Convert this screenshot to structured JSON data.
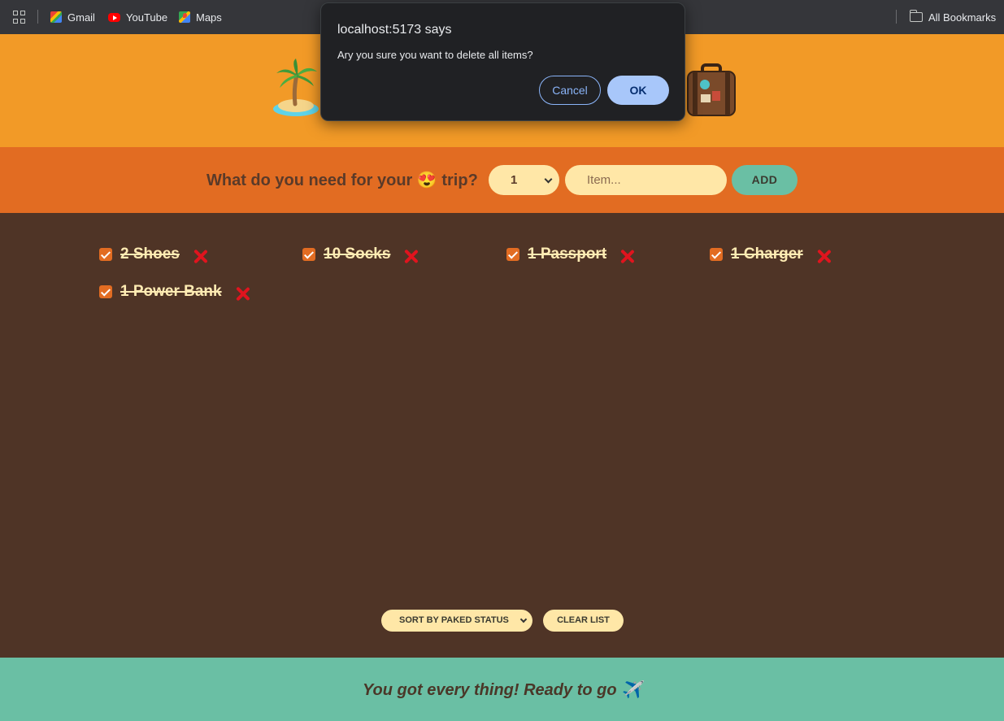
{
  "bookmarks": {
    "items": [
      {
        "label": "Gmail",
        "icon": "gmail-icon"
      },
      {
        "label": "YouTube",
        "icon": "youtube-icon"
      },
      {
        "label": "Maps",
        "icon": "maps-icon"
      }
    ],
    "all_bookmarks": "All Bookmarks"
  },
  "header": {
    "left_emoji": "palm-tree-island-icon",
    "right_emoji": "suitcase-icon",
    "background": "#f29a27"
  },
  "form": {
    "question": "What do you need for your 😍 trip?",
    "quantity_selected": "1",
    "item_placeholder": "Item...",
    "add_label": "ADD"
  },
  "items": [
    {
      "quantity": 2,
      "description": "Shoes",
      "label": "2 Shoes",
      "packed": true
    },
    {
      "quantity": 10,
      "description": "Socks",
      "label": "10 Socks",
      "packed": true
    },
    {
      "quantity": 1,
      "description": "Passport",
      "label": "1 Passport",
      "packed": true
    },
    {
      "quantity": 1,
      "description": "Charger",
      "label": "1 Charger",
      "packed": true
    },
    {
      "quantity": 1,
      "description": "Power Bank",
      "label": "1 Power Bank",
      "packed": true
    }
  ],
  "actions": {
    "sort_selected": "SORT BY PAKED STATUS",
    "clear_label": "CLEAR LIST"
  },
  "stats": {
    "text": "You got every thing! Ready to go ✈️"
  },
  "dialog": {
    "title": "localhost:5173 says",
    "message": "Ary you sure you want to delete all items?",
    "cancel_label": "Cancel",
    "ok_label": "OK"
  },
  "colors": {
    "orange": "#f29a27",
    "dark_orange": "#e26c22",
    "brown": "#4f3426",
    "teal": "#6abfa4",
    "cream": "#ffe7a7",
    "delete_red": "#e0141e"
  }
}
